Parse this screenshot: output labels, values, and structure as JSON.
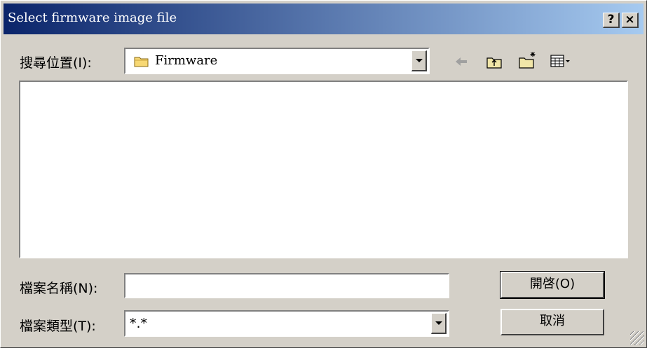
{
  "window": {
    "title": "Select firmware image file"
  },
  "titlebar": {
    "help_label": "?",
    "close_label": "×"
  },
  "lookin": {
    "label": "搜尋位置(I):",
    "value": "Firmware"
  },
  "toolbar": {
    "icons": [
      "back-arrow-icon",
      "up-folder-icon",
      "new-folder-icon",
      "view-menu-icon"
    ]
  },
  "filename": {
    "label": "檔案名稱(N):",
    "value": ""
  },
  "filetype": {
    "label": "檔案類型(T):",
    "value": "*.*"
  },
  "buttons": {
    "open": "開啓(O)",
    "cancel": "取消"
  }
}
